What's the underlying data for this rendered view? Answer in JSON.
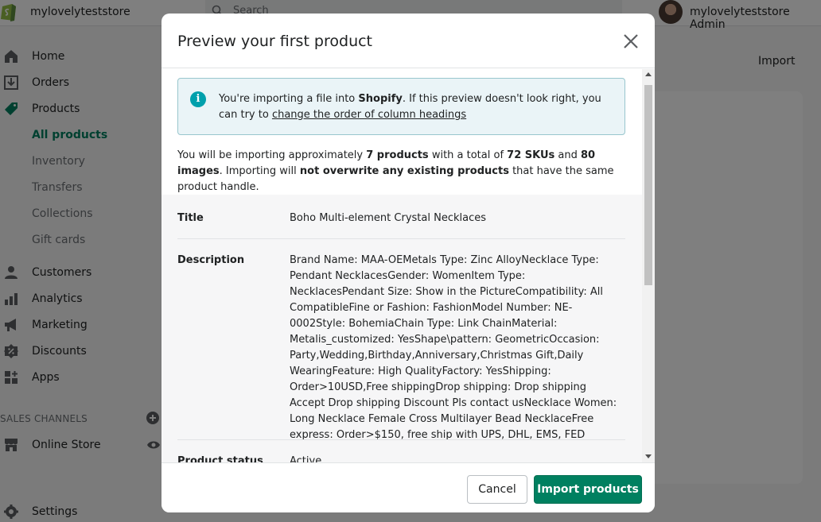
{
  "topbar": {
    "store_name": "mylovelyteststore",
    "search_placeholder": "Search",
    "admin_name": "mylovelyteststore Admin"
  },
  "sidebar": {
    "items": [
      {
        "label": "Home",
        "icon": "home-icon"
      },
      {
        "label": "Orders",
        "icon": "orders-icon"
      },
      {
        "label": "Products",
        "icon": "tag-icon"
      },
      {
        "label": "All products"
      },
      {
        "label": "Inventory"
      },
      {
        "label": "Transfers"
      },
      {
        "label": "Collections"
      },
      {
        "label": "Gift cards"
      },
      {
        "label": "Customers",
        "icon": "customer-icon"
      },
      {
        "label": "Analytics",
        "icon": "analytics-icon"
      },
      {
        "label": "Marketing",
        "icon": "megaphone-icon"
      },
      {
        "label": "Discounts",
        "icon": "discount-icon"
      },
      {
        "label": "Apps",
        "icon": "apps-icon"
      }
    ],
    "sales_channels_title": "SALES CHANNELS",
    "online_store_label": "Online Store",
    "settings_label": "Settings"
  },
  "main": {
    "import_label": "Import"
  },
  "modal": {
    "title": "Preview your first product",
    "banner": {
      "prefix": "You're importing a file into ",
      "brand": "Shopify",
      "middle": ". If this preview doesn't look right, you can try to ",
      "link": "change the order of column headings"
    },
    "summary": {
      "p1": "You will be importing approximately ",
      "products": "7 products",
      "p2": " with a total of ",
      "skus": "72 SKUs",
      "p3": " and ",
      "images": "80 images",
      "p4": ". Importing will ",
      "not_overwrite": "not overwrite any existing products",
      "p5": " that have the same product handle."
    },
    "fields": [
      {
        "label": "Title",
        "value": "Boho Multi-element Crystal Necklaces"
      },
      {
        "label": "Description",
        "value": "Brand Name: MAA-OEMetals Type: Zinc AlloyNecklace Type: Pendant NecklacesGender: WomenItem Type: NecklacesPendant Size: Show in the PictureCompatibility: All CompatibleFine or Fashion: FashionModel Number: NE-0002Style: BohemiaChain Type: Link ChainMaterial: Metalis_customized: YesShape\\pattern: GeometricOccasion: Party,Wedding,Birthday,Anniversary,Christmas Gift,Daily WearingFeature: High QualityFactory: YesShipping: Order>10USD,Free shippingDrop shipping: Drop shipping Accept Drop shipping Discount Pls contact usNecklace Women: Long Necklace Female Cross Multilayer Bead NecklaceFree express: Order>$150, free ship with UPS, DHL, EMS, FED"
      },
      {
        "label": "Product status",
        "value": "Active"
      }
    ],
    "cancel_label": "Cancel",
    "import_label": "Import products"
  }
}
